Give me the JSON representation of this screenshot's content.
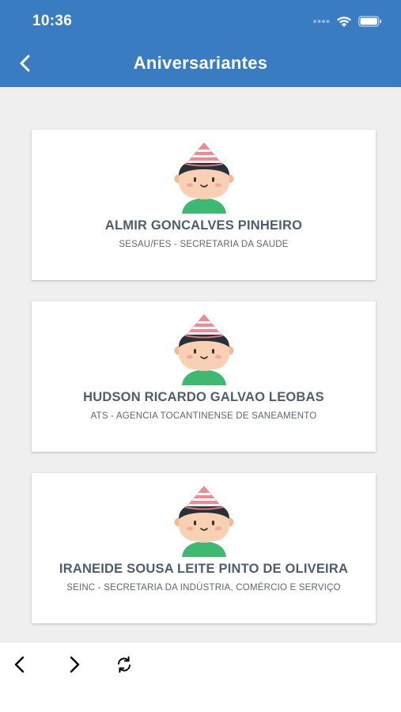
{
  "status_bar": {
    "time": "10:36",
    "icons": [
      "signal-dots-icon",
      "wifi-icon",
      "battery-icon"
    ]
  },
  "header": {
    "title": "Aniversariantes",
    "back_icon": "chevron-left-icon",
    "background_color": "#3a7cc1"
  },
  "birthdays": [
    {
      "name": "ALMIR GONCALVES PINHEIRO",
      "department": "SESAU/FES - SECRETARIA DA SAUDE"
    },
    {
      "name": "HUDSON RICARDO GALVAO LEOBAS",
      "department": "ATS - AGENCIA TOCANTINENSE DE SANEAMENTO"
    },
    {
      "name": "IRANEIDE SOUSA LEITE PINTO DE OLIVEIRA",
      "department": "SEINC - SECRETARIA DA INDÚSTRIA, COMÉRCIO E SERVIÇO"
    }
  ],
  "bottom_bar": {
    "icons": [
      "back-arrow-icon",
      "forward-arrow-icon",
      "refresh-icon"
    ]
  }
}
